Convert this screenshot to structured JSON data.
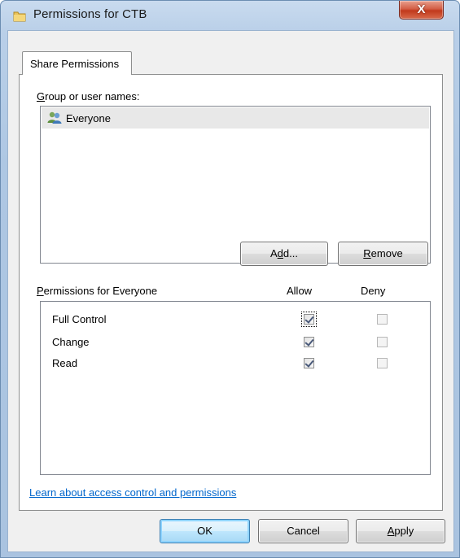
{
  "window": {
    "title": "Permissions for CTB",
    "close_glyph": "X"
  },
  "tabs": [
    {
      "label": "Share Permissions",
      "selected": true
    }
  ],
  "groups": {
    "label_hotkey": "G",
    "label_rest": "roup or user names:",
    "items": [
      {
        "name": "Everyone",
        "icon": "users-group-icon",
        "selected": true
      }
    ]
  },
  "buttons": {
    "add_pre": "A",
    "add_hotkey": "d",
    "add_post": "d...",
    "remove_hotkey": "R",
    "remove_rest": "emove"
  },
  "permissions": {
    "label_hotkey": "P",
    "label_rest": "ermissions for Everyone",
    "allow_header": "Allow",
    "deny_header": "Deny",
    "rows": [
      {
        "name": "Full Control",
        "allow": true,
        "deny": false
      },
      {
        "name": "Change",
        "allow": true,
        "deny": false
      },
      {
        "name": "Read",
        "allow": true,
        "deny": false
      }
    ]
  },
  "help_link": "Learn about access control and permissions",
  "footer": {
    "ok": "OK",
    "cancel": "Cancel",
    "apply_hotkey": "A",
    "apply_rest": "pply"
  },
  "colors": {
    "link": "#0066cc",
    "close_button": "#c1391c",
    "selection": "#e8e8e8"
  }
}
